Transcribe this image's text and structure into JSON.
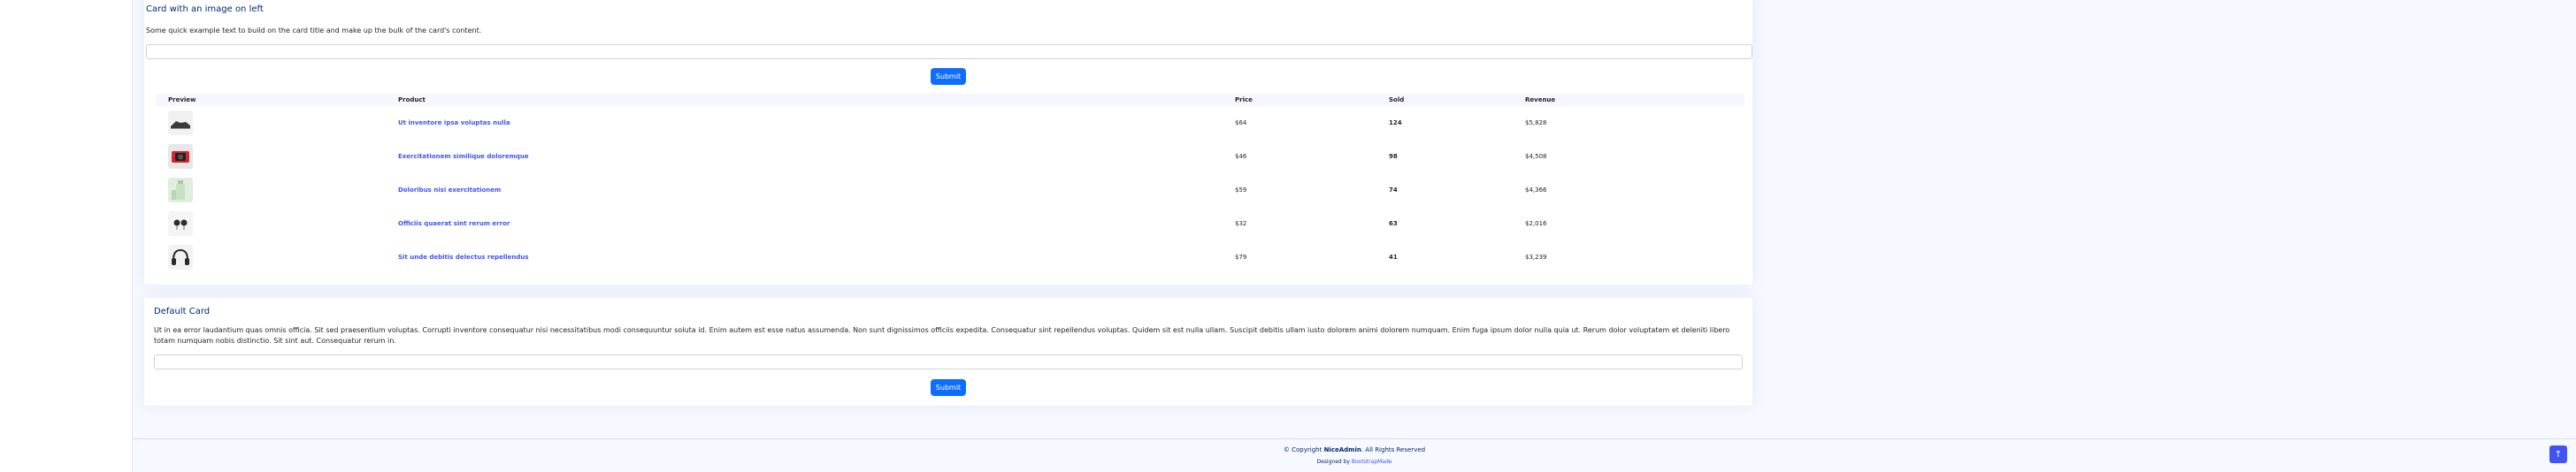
{
  "card1": {
    "title": "Card with an image on left",
    "text": "Some quick example text to build on the card title and make up the bulk of the card's content.",
    "submit_label": "Submit"
  },
  "table": {
    "headers": [
      "Preview",
      "Product",
      "Price",
      "Sold",
      "Revenue"
    ],
    "rows": [
      {
        "preview": "shoe-icon",
        "product": "Ut inventore ipsa voluptas nulla",
        "price": "$64",
        "sold": "124",
        "revenue": "$5,828"
      },
      {
        "preview": "camera-icon",
        "product": "Exercitationem similique doloremque",
        "price": "$46",
        "sold": "98",
        "revenue": "$4,508"
      },
      {
        "preview": "bottle-icon",
        "product": "Doloribus nisi exercitationem",
        "price": "$59",
        "sold": "74",
        "revenue": "$4,366"
      },
      {
        "preview": "earrings-icon",
        "product": "Officiis quaerat sint rerum error",
        "price": "$32",
        "sold": "63",
        "revenue": "$2,016"
      },
      {
        "preview": "headphones-icon",
        "product": "Sit unde debitis delectus repellendus",
        "price": "$79",
        "sold": "41",
        "revenue": "$3,239"
      }
    ]
  },
  "card2": {
    "title": "Default Card",
    "text": "Ut in ea error laudantium quas omnis officia. Sit sed praesentium voluptas. Corrupti inventore consequatur nisi necessitatibus modi consequuntur soluta id. Enim autem est esse natus assumenda. Non sunt dignissimos officiis expedita. Consequatur sint repellendus voluptas. Quidem sit est nulla ullam. Suscipit debitis ullam iusto dolorem animi dolorem numquam. Enim fuga ipsum dolor nulla quia ut. Rerum dolor voluptatem et deleniti libero totam numquam nobis distinctio. Sit sint aut. Consequatur rerum in.",
    "submit_label": "Submit"
  },
  "footer": {
    "copyright_prefix": "© Copyright",
    "brand": "NiceAdmin",
    "copyright_suffix": ". All Rights Reserved",
    "designed_prefix": "Designed by",
    "designed_link": "BootstrapMade"
  },
  "back_to_top": {
    "icon": "arrow-up-icon",
    "glyph": "↑"
  },
  "colors": {
    "accent": "#4154f1",
    "button": "#0d6efd",
    "title": "#012970",
    "background": "#f6f9ff"
  }
}
